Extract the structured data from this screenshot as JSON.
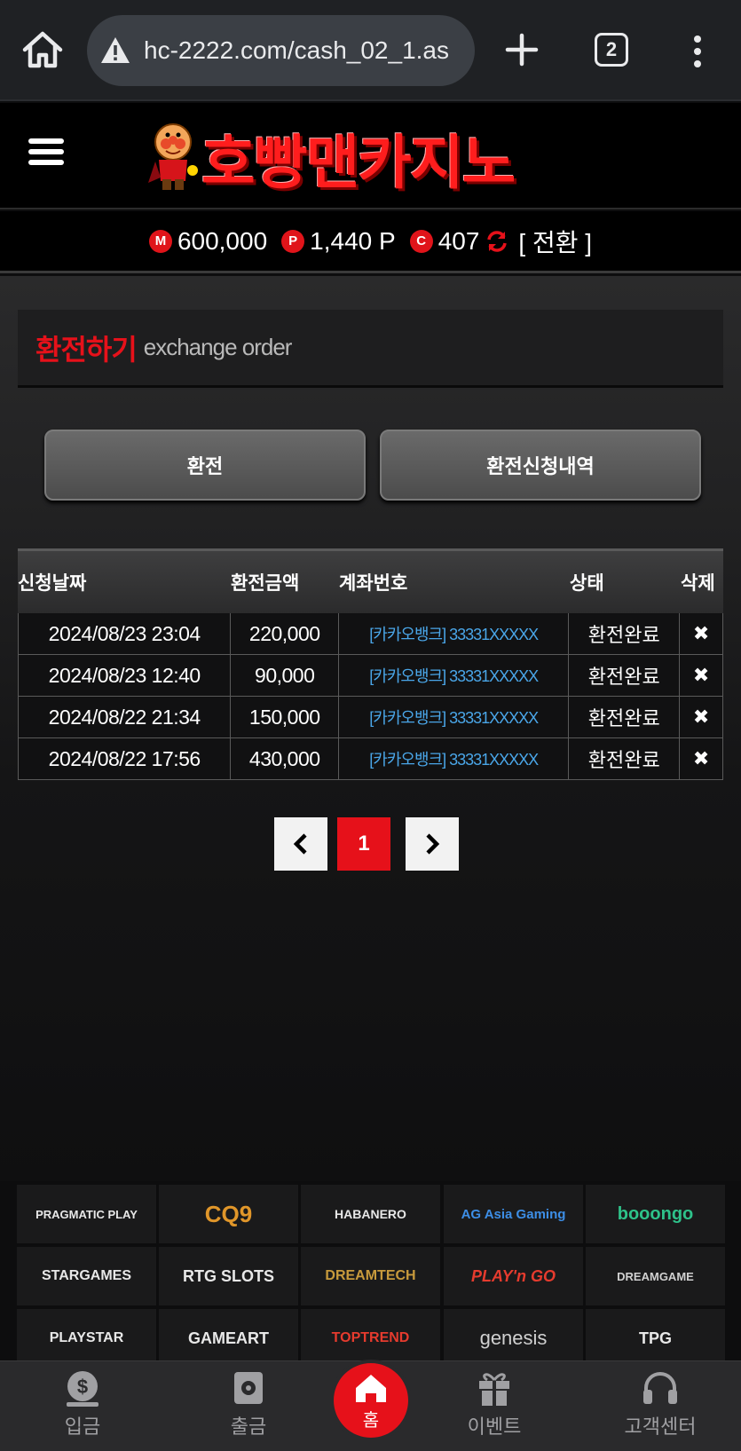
{
  "browser": {
    "url": "hc-2222.com/cash_02_1.as",
    "tab_count": "2"
  },
  "site": {
    "logo_text": "호빵맨카지노"
  },
  "balance": {
    "money": "600,000",
    "money_badge": "M",
    "point": "1,440 P",
    "point_badge": "P",
    "coin": "407",
    "coin_badge": "C",
    "convert_label": "[ 전환 ]"
  },
  "section": {
    "title_ko": "환전하기",
    "title_en": "exchange order"
  },
  "tabs": [
    {
      "label": "환전"
    },
    {
      "label": "환전신청내역"
    }
  ],
  "table": {
    "headers": [
      "신청날짜",
      "환전금액",
      "계좌번호",
      "상태",
      "삭제"
    ],
    "rows": [
      {
        "date": "2024/08/23 23:04",
        "amount": "220,000",
        "account": "[카카오뱅크] 33331XXXXX",
        "status": "환전완료",
        "delete": "✖"
      },
      {
        "date": "2024/08/23 12:40",
        "amount": "90,000",
        "account": "[카카오뱅크] 33331XXXXX",
        "status": "환전완료",
        "delete": "✖"
      },
      {
        "date": "2024/08/22 21:34",
        "amount": "150,000",
        "account": "[카카오뱅크] 33331XXXXX",
        "status": "환전완료",
        "delete": "✖"
      },
      {
        "date": "2024/08/22 17:56",
        "amount": "430,000",
        "account": "[카카오뱅크] 33331XXXXX",
        "status": "환전완료",
        "delete": "✖"
      }
    ]
  },
  "pagination": {
    "current": "1",
    "prev_icon": "chevron-left-icon",
    "next_icon": "chevron-right-icon"
  },
  "providers": [
    {
      "name": "PRAGMATIC PLAY",
      "color": "#e8e8e8"
    },
    {
      "name": "CQ9",
      "color": "#e0962a"
    },
    {
      "name": "HABANERO",
      "color": "#e8e8e8"
    },
    {
      "name": "AG Asia Gaming",
      "color": "#3d8ee6"
    },
    {
      "name": "booongo",
      "color": "#2ec28a"
    },
    {
      "name": "STARGAMES",
      "color": "#e8e8e8"
    },
    {
      "name": "RTG SLOTS",
      "color": "#e8e8e8"
    },
    {
      "name": "DREAMTECH",
      "color": "#c89a3c"
    },
    {
      "name": "PLAY'n GO",
      "color": "#e63b2e"
    },
    {
      "name": "DREAMGAME",
      "color": "#d0d0d0"
    },
    {
      "name": "PLAYSTAR",
      "color": "#e8e8e8"
    },
    {
      "name": "GAMEART",
      "color": "#e8e8e8"
    },
    {
      "name": "TOPTREND",
      "color": "#e63b2e"
    },
    {
      "name": "genesis",
      "color": "#d0d0d0"
    },
    {
      "name": "TPG",
      "color": "#e8e8e8"
    }
  ],
  "bottom_nav": {
    "deposit": "입금",
    "withdraw": "출금",
    "home": "홈",
    "event": "이벤트",
    "support": "고객센터"
  },
  "colors": {
    "accent": "#e6111a",
    "link": "#4aa6e8"
  }
}
